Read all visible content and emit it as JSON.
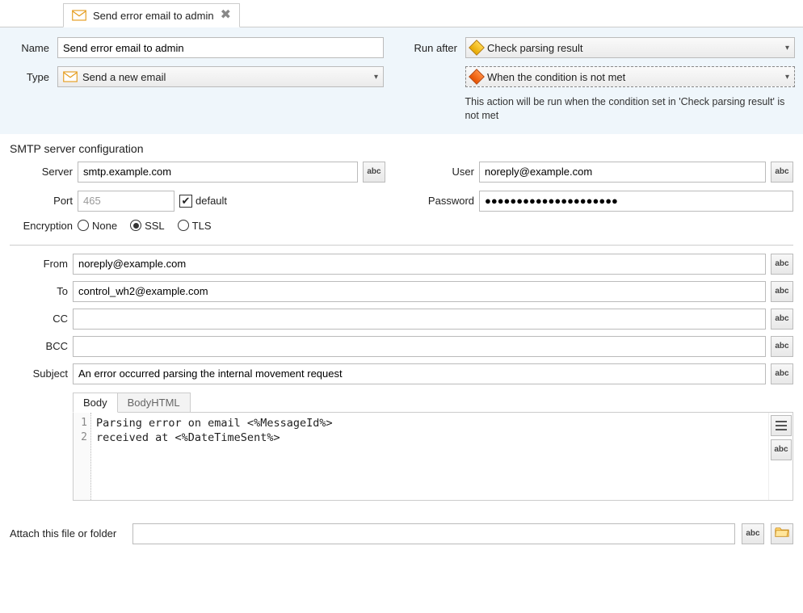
{
  "tab": {
    "title": "Send error email to admin"
  },
  "top": {
    "name_label": "Name",
    "name_value": "Send error email to admin",
    "type_label": "Type",
    "type_value": "Send a new email",
    "run_after_label": "Run after",
    "run_after_value": "Check parsing result",
    "condition_value": "When the condition is not met",
    "hint": "This action will be run when the condition set in 'Check parsing result' is not met"
  },
  "smtp": {
    "title": "SMTP server configuration",
    "server_label": "Server",
    "server_value": "smtp.example.com",
    "user_label": "User",
    "user_value": "noreply@example.com",
    "port_label": "Port",
    "port_value": "465",
    "default_label": "default",
    "password_label": "Password",
    "password_value": "●●●●●●●●●●●●●●●●●●●●●",
    "encryption_label": "Encryption",
    "enc_none": "None",
    "enc_ssl": "SSL",
    "enc_tls": "TLS",
    "enc_selected": "SSL"
  },
  "email": {
    "from_label": "From",
    "from_value": "noreply@example.com",
    "to_label": "To",
    "to_value": "control_wh2@example.com",
    "cc_label": "CC",
    "cc_value": "",
    "bcc_label": "BCC",
    "bcc_value": "",
    "subject_label": "Subject",
    "subject_value": "An error occurred parsing the internal movement request"
  },
  "body": {
    "tab_body": "Body",
    "tab_html": "BodyHTML",
    "line1": "Parsing error on email <%MessageId%>",
    "line2": "received at <%DateTimeSent%>",
    "gutter1": "1",
    "gutter2": "2"
  },
  "attach": {
    "label": "Attach this file or folder",
    "value": ""
  },
  "btn": {
    "abc": "abc"
  }
}
